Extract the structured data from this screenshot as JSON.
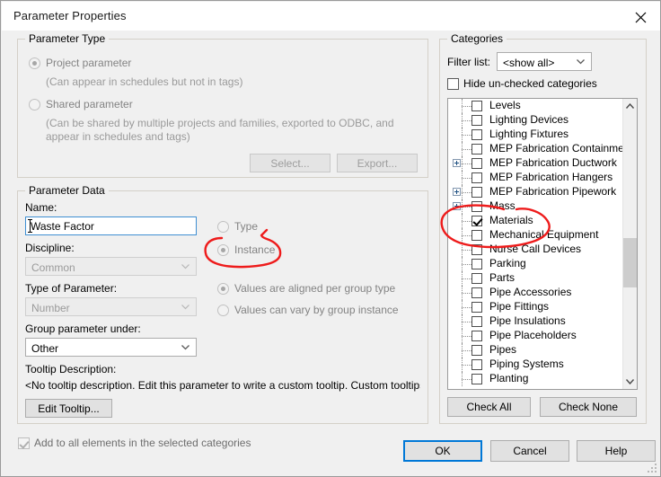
{
  "window": {
    "title": "Parameter Properties",
    "close_icon": "close-icon"
  },
  "parameter_type": {
    "legend": "Parameter Type",
    "project": {
      "label": "Project parameter",
      "selected": true,
      "enabled": false,
      "description": "(Can appear in schedules but not in tags)"
    },
    "shared": {
      "label": "Shared parameter",
      "selected": false,
      "enabled": false,
      "description_line1": "(Can be shared by multiple projects and families, exported to ODBC, and",
      "description_line2": "appear in schedules and tags)"
    },
    "select_button": "Select...",
    "export_button": "Export..."
  },
  "parameter_data": {
    "legend": "Parameter Data",
    "name_label": "Name:",
    "name_value": "Waste Factor",
    "name_placeholder": "",
    "discipline_label": "Discipline:",
    "discipline_value": "Common",
    "type_of_parameter_label": "Type of Parameter:",
    "type_of_parameter_value": "Number",
    "group_under_label": "Group parameter under:",
    "group_under_value": "Other",
    "tooltip_label": "Tooltip Description:",
    "tooltip_value": "<No tooltip description. Edit this parameter to write a custom tooltip. Custom tooltips hav...",
    "edit_tooltip_button": "Edit Tooltip...",
    "type_radio": {
      "label": "Type",
      "selected": false
    },
    "instance_radio": {
      "label": "Instance",
      "selected": true
    },
    "aligned_radio": {
      "label": "Values are aligned per group type",
      "selected": true
    },
    "vary_radio": {
      "label": "Values can vary by group instance",
      "selected": false
    }
  },
  "footer": {
    "add_to_all": {
      "label": "Add to all elements in the selected categories",
      "checked": true,
      "enabled": false
    },
    "ok_button": "OK",
    "cancel_button": "Cancel",
    "help_button": "Help"
  },
  "categories": {
    "legend": "Categories",
    "filter_label": "Filter list:",
    "filter_value": "<show all>",
    "hide_unchecked": {
      "label": "Hide un-checked categories",
      "checked": false
    },
    "check_all_button": "Check All",
    "check_none_button": "Check None",
    "items": [
      {
        "label": "Levels",
        "checked": false,
        "expandable": false
      },
      {
        "label": "Lighting Devices",
        "checked": false,
        "expandable": false
      },
      {
        "label": "Lighting Fixtures",
        "checked": false,
        "expandable": false
      },
      {
        "label": "MEP Fabrication Containment",
        "checked": false,
        "expandable": false
      },
      {
        "label": "MEP Fabrication Ductwork",
        "checked": false,
        "expandable": true
      },
      {
        "label": "MEP Fabrication Hangers",
        "checked": false,
        "expandable": false
      },
      {
        "label": "MEP Fabrication Pipework",
        "checked": false,
        "expandable": true
      },
      {
        "label": "Mass",
        "checked": false,
        "expandable": true
      },
      {
        "label": "Materials",
        "checked": true,
        "expandable": false
      },
      {
        "label": "Mechanical Equipment",
        "checked": false,
        "expandable": false
      },
      {
        "label": "Nurse Call Devices",
        "checked": false,
        "expandable": false
      },
      {
        "label": "Parking",
        "checked": false,
        "expandable": false
      },
      {
        "label": "Parts",
        "checked": false,
        "expandable": false
      },
      {
        "label": "Pipe Accessories",
        "checked": false,
        "expandable": false
      },
      {
        "label": "Pipe Fittings",
        "checked": false,
        "expandable": false
      },
      {
        "label": "Pipe Insulations",
        "checked": false,
        "expandable": false
      },
      {
        "label": "Pipe Placeholders",
        "checked": false,
        "expandable": false
      },
      {
        "label": "Pipes",
        "checked": false,
        "expandable": false
      },
      {
        "label": "Piping Systems",
        "checked": false,
        "expandable": false
      },
      {
        "label": "Planting",
        "checked": false,
        "expandable": false
      }
    ],
    "scrollbar": {
      "up_icon": "chevron-up-icon",
      "down_icon": "chevron-down-icon"
    }
  },
  "annotations": {
    "ink_color": "#ee1b1b",
    "marks": [
      {
        "name": "instance-circle",
        "target": "Instance"
      },
      {
        "name": "materials-circle",
        "target": "Materials"
      }
    ]
  }
}
